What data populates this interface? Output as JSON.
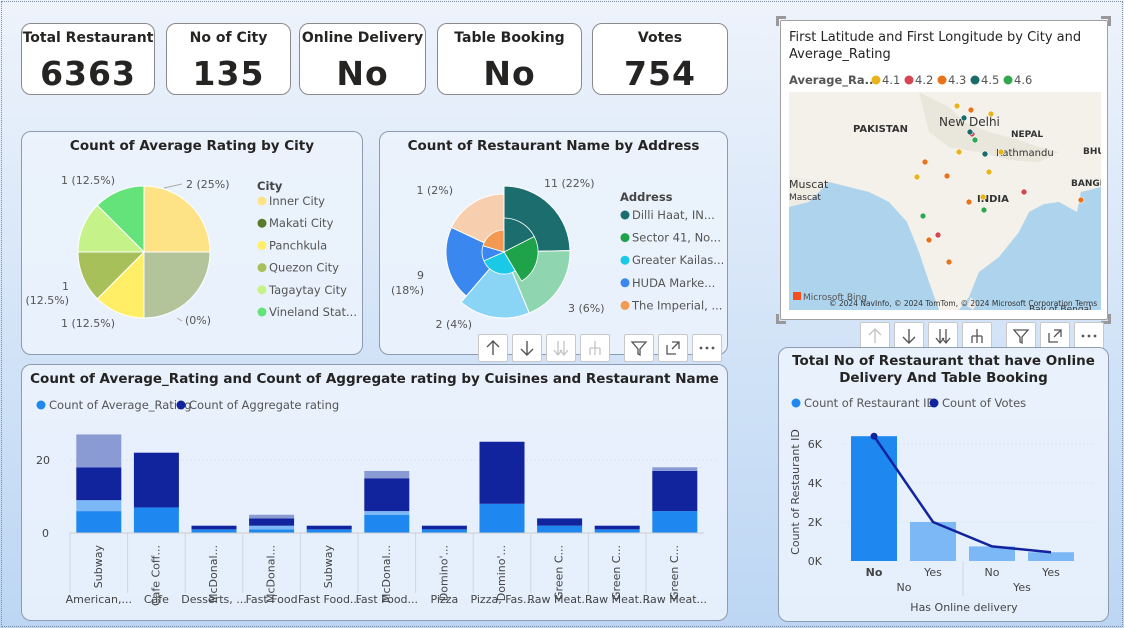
{
  "kpis": [
    {
      "title": "Total Restaurant",
      "value": "6363"
    },
    {
      "title": "No of City",
      "value": "135"
    },
    {
      "title": "Online Delivery",
      "value": "No"
    },
    {
      "title": "Table Booking",
      "value": "No"
    },
    {
      "title": "Votes",
      "value": "754"
    }
  ],
  "map": {
    "title_line1": "First Latitude and First Longitude by City and",
    "title_line2": "Average_Rating",
    "legend_title": "Average_Ra...",
    "legend": [
      {
        "label": "4.1",
        "color": "#e8b41a"
      },
      {
        "label": "4.2",
        "color": "#d64550"
      },
      {
        "label": "4.3",
        "color": "#e8731a"
      },
      {
        "label": "4.5",
        "color": "#1a6b6b"
      },
      {
        "label": "4.6",
        "color": "#2fa84f"
      }
    ],
    "labels": {
      "pakistan": "PAKISTAN",
      "new_delhi": "New Delhi",
      "nepal": "NEPAL",
      "kathmandu": "Kathmandu",
      "muscat": "Muscat",
      "muscat2": "Mascat",
      "india": "INDIA",
      "bangl": "BANGL",
      "bhu": "BHU",
      "bay": "Bay of Bengal",
      "bing": "Microsoft Bing",
      "copyright": "© 2024 NavInfo, © 2024 TomTom, © 2024 Microsoft Corporation  Terms"
    }
  },
  "chart_data": [
    {
      "type": "pie",
      "title": "Count of Average Rating by City",
      "legend_title": "City",
      "slices": [
        {
          "name": "Inner City",
          "value": 2,
          "label": "2 (25%)",
          "color": "#fde286"
        },
        {
          "name": "Makati City",
          "value": 0,
          "label": "(0%)",
          "color": "#5a7a2a"
        },
        {
          "name": "Panchkula",
          "value": 1,
          "label": "1 (12.5%)",
          "color": "#ffee66"
        },
        {
          "name": "Quezon City",
          "value": 1,
          "label": "1 (12.5%)",
          "color": "#a8c05a"
        },
        {
          "name": "Tagaytay City",
          "value": 1,
          "label": "1 (12.5%)",
          "color": "#c6f28a"
        },
        {
          "name": "Vineland Stat...",
          "value": 1,
          "label": "1 (12.5%)",
          "color": "#63e37a"
        }
      ],
      "extra_slices": [
        {
          "value": 2,
          "color": "#b3c39a"
        }
      ]
    },
    {
      "type": "pie",
      "title": "Count of Restaurant Name by Address",
      "legend_title": "Address",
      "slices": [
        {
          "name": "Dilli Haat, IN...",
          "value": 11,
          "label": "11 (22%)",
          "color": "#1c6e6e"
        },
        {
          "name": "Sector 41, No...",
          "value": 3,
          "label": "3 (6%)",
          "color": "#1fa34a"
        },
        {
          "name": "Greater Kailas...",
          "value": 2,
          "label": "2 (4%)",
          "color": "#19c9e6"
        },
        {
          "name": "HUDA Marke...",
          "value": 9,
          "label": "9 (18%)",
          "color": "#3a87f0"
        },
        {
          "name": "The Imperial, ...",
          "value": 1,
          "label": "1 (2%)",
          "color": "#f39a52"
        }
      ]
    },
    {
      "type": "bar",
      "title": "Count of Average_Rating and Count of Aggregate rating by Cuisines and Restaurant Name",
      "series": [
        {
          "name": "Count of Average_Rating",
          "color": "#1e88f0"
        },
        {
          "name": "Count of Aggregate rating",
          "color": "#12239e"
        }
      ],
      "ylim": [
        0,
        30
      ],
      "yticks": [
        "0",
        "20"
      ],
      "categories": [
        {
          "sub": "Subway",
          "group": "American,...",
          "stacks": [
            [
              6,
              "#1e88f0"
            ],
            [
              3,
              "#7cb8f5"
            ],
            [
              9,
              "#12239e"
            ],
            [
              9,
              "#8a9bd4"
            ]
          ]
        },
        {
          "sub": "Cafe Coff...",
          "group": "Cafe",
          "stacks": [
            [
              7,
              "#1e88f0"
            ],
            [
              15,
              "#12239e"
            ]
          ]
        },
        {
          "sub": "McDonal...",
          "group": "Desserts, ...",
          "stacks": [
            [
              1,
              "#1e88f0"
            ],
            [
              1,
              "#12239e"
            ]
          ]
        },
        {
          "sub": "McDonal...",
          "group": "Fast Food",
          "stacks": [
            [
              1,
              "#1e88f0"
            ],
            [
              1,
              "#7cb8f5"
            ],
            [
              2,
              "#12239e"
            ],
            [
              1,
              "#8a9bd4"
            ]
          ]
        },
        {
          "sub": "Subway",
          "group": "Fast Food...",
          "stacks": [
            [
              1,
              "#1e88f0"
            ],
            [
              1,
              "#12239e"
            ]
          ]
        },
        {
          "sub": "McDonal...",
          "group": "Fast Food...",
          "stacks": [
            [
              5,
              "#1e88f0"
            ],
            [
              1,
              "#7cb8f5"
            ],
            [
              9,
              "#12239e"
            ],
            [
              2,
              "#8a9bd4"
            ]
          ]
        },
        {
          "sub": "Domino'...",
          "group": "Pizza",
          "stacks": [
            [
              1,
              "#1e88f0"
            ],
            [
              1,
              "#12239e"
            ]
          ]
        },
        {
          "sub": "Domino'...",
          "group": "Pizza, Fas...",
          "stacks": [
            [
              8,
              "#1e88f0"
            ],
            [
              17,
              "#12239e"
            ]
          ]
        },
        {
          "sub": "Green C...",
          "group": "Raw Meat...",
          "stacks": [
            [
              2,
              "#1e88f0"
            ],
            [
              2,
              "#12239e"
            ]
          ]
        },
        {
          "sub": "Green C...",
          "group": "Raw Meat...",
          "stacks": [
            [
              1,
              "#1e88f0"
            ],
            [
              1,
              "#12239e"
            ]
          ]
        },
        {
          "sub": "Green C...",
          "group": "Raw Meat...",
          "stacks": [
            [
              6,
              "#1e88f0"
            ],
            [
              11,
              "#12239e"
            ],
            [
              1,
              "#8a9bd4"
            ]
          ]
        }
      ]
    },
    {
      "type": "bar",
      "title_line1": "Total No of Restaurant that have Online",
      "title_line2": "Delivery And Table Booking",
      "series": [
        {
          "name": "Count of Restaurant ID",
          "color": "#1e88f0"
        },
        {
          "name": "Count of Votes",
          "color": "#12239e"
        }
      ],
      "ylabel": "Count of Restaurant ID",
      "xlabel": "Has Online delivery",
      "ylim": [
        0,
        7000
      ],
      "yticks": [
        "0K",
        "2K",
        "4K",
        "6K"
      ],
      "categories": [
        "No",
        "Yes",
        "No",
        "Yes"
      ],
      "groups": [
        "No",
        "Yes"
      ],
      "values": [
        6400,
        2000,
        750,
        450
      ],
      "line": [
        6400,
        2000,
        750,
        450
      ]
    }
  ]
}
